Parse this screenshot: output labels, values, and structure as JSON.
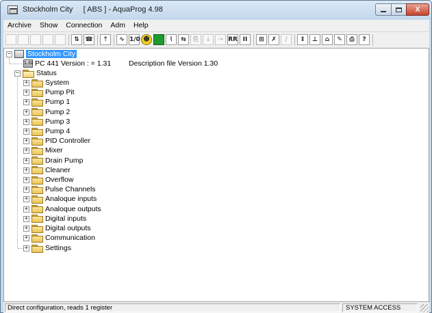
{
  "window": {
    "title": "Stockholm City     [ ABS ] - AquaProg 4.98",
    "icon": "app-window-icon",
    "controls": {
      "minimize": "minimize-icon",
      "maximize": "maximize-icon",
      "close": "X"
    }
  },
  "menu": [
    {
      "label": "Archive"
    },
    {
      "label": "Show"
    },
    {
      "label": "Connection"
    },
    {
      "label": "Adm"
    },
    {
      "label": "Help"
    }
  ],
  "toolbar": {
    "buttons": [
      {
        "name": "new-icon",
        "glyph": ""
      },
      {
        "name": "open-icon",
        "glyph": ""
      },
      {
        "name": "save-icon",
        "glyph": ""
      },
      {
        "name": "save-as-icon",
        "glyph": ""
      },
      {
        "name": "export-icon",
        "glyph": ""
      },
      {
        "name": "connect-icon",
        "glyph": "⇅"
      },
      {
        "name": "modem-icon",
        "glyph": "☎"
      },
      {
        "name": "upload-icon",
        "glyph": "⇡"
      },
      {
        "name": "signal-icon",
        "glyph": "∿"
      },
      {
        "name": "io-icon",
        "glyph": "1/0"
      },
      {
        "name": "alarm-icon",
        "glyph": "☻"
      },
      {
        "name": "status-green-icon",
        "glyph": ""
      },
      {
        "name": "chart-icon",
        "glyph": "⌇"
      },
      {
        "name": "compare-icon",
        "glyph": "⇆"
      },
      {
        "name": "copy-icon",
        "glyph": "⎘"
      },
      {
        "name": "download-icon",
        "glyph": "⇣"
      },
      {
        "name": "transfer-icon",
        "glyph": "⇢"
      },
      {
        "name": "rr-icon",
        "glyph": "RR"
      },
      {
        "name": "ii-icon",
        "glyph": "II"
      },
      {
        "name": "table-icon",
        "glyph": "⊞"
      },
      {
        "name": "tools-icon",
        "glyph": "✗"
      },
      {
        "name": "graph-icon",
        "glyph": "∕"
      },
      {
        "name": "level-icon",
        "glyph": "⇕"
      },
      {
        "name": "pump-icon",
        "glyph": "⊥"
      },
      {
        "name": "tank-icon",
        "glyph": "⌂"
      },
      {
        "name": "edit-icon",
        "glyph": "✎"
      },
      {
        "name": "print-icon",
        "glyph": "⎙"
      },
      {
        "name": "help-icon",
        "glyph": "?"
      }
    ]
  },
  "tree": {
    "root": "Stockholm City",
    "version_node": "PC 441 Version : = 1.31",
    "version_icon_label": "1.31",
    "description": "Description file Version 1.30",
    "status_label": "Status",
    "status_children": [
      "System",
      "Pump Pit",
      "Pump 1",
      "Pump 2",
      "Pump 3",
      "Pump 4",
      "PID Controller",
      "Mixer",
      "Drain Pump",
      "Cleaner",
      "Overflow",
      "Pulse Channels",
      "Analoque inputs",
      "Analoque outputs",
      "Digital inputs",
      "Digital outputs",
      "Communication"
    ],
    "settings_label": "Settings"
  },
  "statusbar": {
    "message": "Direct configuration, reads 1 register",
    "access": "SYSTEM ACCESS"
  }
}
